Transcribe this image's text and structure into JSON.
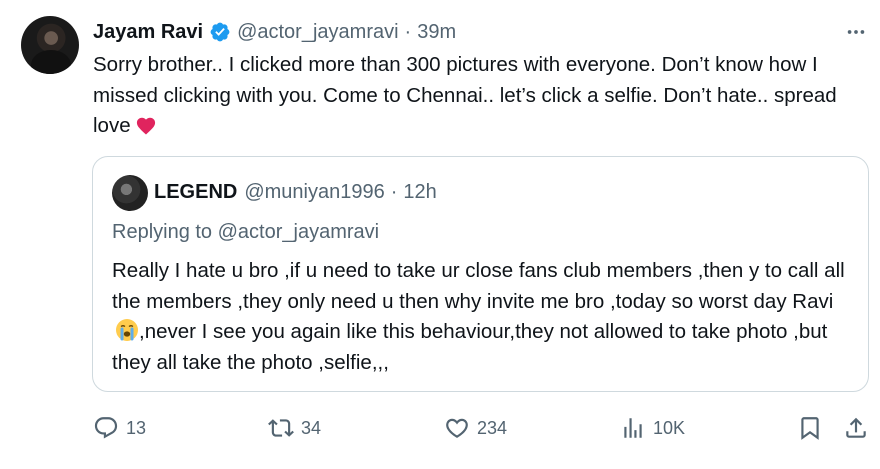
{
  "tweet": {
    "display_name": "Jayam Ravi",
    "handle": "@actor_jayamravi",
    "separator": "·",
    "time": "39m",
    "text": "Sorry brother.. I clicked more than 300 pictures with everyone. Don’t know how I missed clicking with you. Come to Chennai.. let’s click a selfie. Don’t hate.. spread love",
    "emoji": "red-heart"
  },
  "quote": {
    "display_name": "LEGEND",
    "handle": "@muniyan1996",
    "separator": "·",
    "time": "12h",
    "replying_to": "Replying to @actor_jayamravi",
    "text_before_emoji": "Really I hate u bro ,if u need to take ur close fans club members ,then y to call all the members ,they only need u then why invite me bro ,today so worst day Ravi",
    "emoji": "loudly-crying-face",
    "text_after_emoji": ",never I see you again like this behaviour,they not allowed to take photo ,but they all take the photo ,selfie,,,"
  },
  "actions": {
    "replies": "13",
    "reposts": "34",
    "likes": "234",
    "views": "10K"
  },
  "colors": {
    "text": "#0f1419",
    "secondary": "#536471",
    "verified": "#1d9bf0",
    "border": "#cfd9de",
    "heart": "#e0245e"
  },
  "icons": [
    "verified-badge-icon",
    "more-icon",
    "reply-icon",
    "repost-icon",
    "like-icon",
    "views-icon",
    "bookmark-icon",
    "share-icon"
  ]
}
